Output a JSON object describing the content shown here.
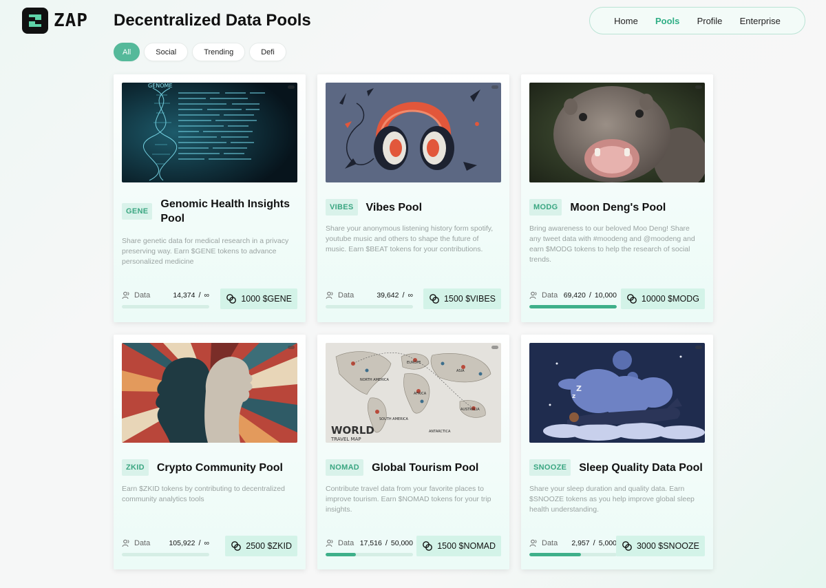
{
  "app": {
    "logo_text": "ZAP",
    "page_title": "Decentralized Data Pools"
  },
  "nav": [
    {
      "label": "Home",
      "active": false
    },
    {
      "label": "Pools",
      "active": true
    },
    {
      "label": "Profile",
      "active": false
    },
    {
      "label": "Enterprise",
      "active": false
    }
  ],
  "filters": [
    {
      "label": "All",
      "active": true
    },
    {
      "label": "Social",
      "active": false
    },
    {
      "label": "Trending",
      "active": false
    },
    {
      "label": "Defi",
      "active": false
    }
  ],
  "colors": {
    "accent": "#3fb08a",
    "tag_bg": "#d9f2ea",
    "reward_bg": "#d3f3e8"
  },
  "pools": [
    {
      "tag": "GENE",
      "title": "Genomic Health Insights Pool",
      "description": "Share genetic data for medical research in a privacy preserving way. Earn $GENE tokens to advance personalized medicine",
      "data_label": "Data",
      "count": "14,374",
      "max": "∞",
      "progress": 0,
      "reward": "1000 $GENE",
      "image": "dna-genome-icon",
      "image_caption": "GENOME"
    },
    {
      "tag": "VIBES",
      "title": "Vibes Pool",
      "description": "Share your anonymous listening history form spotify, youtube music and others to shape the future of music. Earn $BEAT tokens for your contributions.",
      "data_label": "Data",
      "count": "39,642",
      "max": "∞",
      "progress": 0,
      "reward": "1500 $VIBES",
      "image": "headphones-icon"
    },
    {
      "tag": "MODG",
      "title": "Moon Deng's Pool",
      "description": "Bring awareness to our beloved Moo Deng! Share any tweet data with #moodeng and @moodeng and earn $MODG tokens to help the research of social trends.",
      "data_label": "Data",
      "count": "69,420",
      "max": "10,000",
      "progress": 1.0,
      "reward": "10000 $MODG",
      "image": "hippo-photo"
    },
    {
      "tag": "ZKID",
      "title": "Crypto Community Pool",
      "description": "Earn $ZKID tokens by contributing to decentralized community analytics tools",
      "data_label": "Data",
      "count": "105,922",
      "max": "∞",
      "progress": 0,
      "reward": "2500 $ZKID",
      "image": "two-heads-silhouette-icon"
    },
    {
      "tag": "NOMAD",
      "title": "Global Tourism Pool",
      "description": "Contribute travel data from your favorite places to improve tourism. Earn $NOMAD tokens for your trip insights.",
      "data_label": "Data",
      "count": "17,516",
      "max": "50,000",
      "progress": 0.35,
      "reward": "1500 $NOMAD",
      "image": "world-travel-map-icon",
      "map_labels": [
        "WORLD",
        "TRAVEL MAP",
        "NORTH AMERICA",
        "EUROPE",
        "ASIA",
        "AFRICA",
        "SOUTH AMERICA",
        "AUSTRALIA",
        "ANTARCTICA"
      ]
    },
    {
      "tag": "SNOOZE",
      "title": "Sleep Quality Data Pool",
      "description": "Share your sleep duration and quality data. Earn $SNOOZE tokens as you help improve global sleep health understanding.",
      "data_label": "Data",
      "count": "2,957",
      "max": "5,000",
      "progress": 0.59,
      "reward": "3000 $SNOOZE",
      "image": "sleeping-person-moon-icon"
    }
  ]
}
